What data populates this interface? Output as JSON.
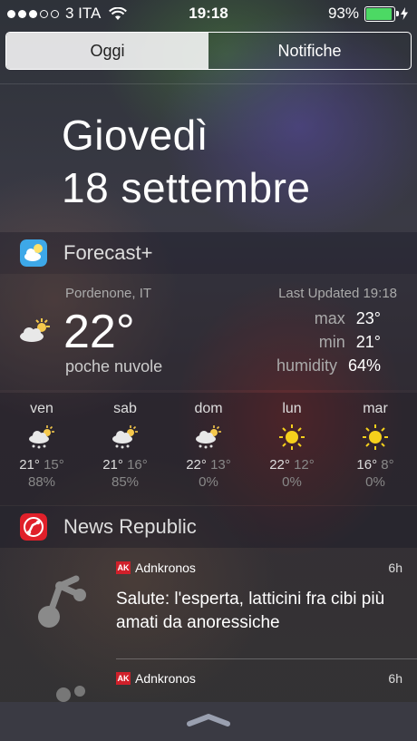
{
  "status": {
    "carrier": "3 ITA",
    "time": "19:18",
    "battery": "93%",
    "battery_level": 0.93
  },
  "tabs": [
    {
      "label": "Oggi",
      "active": true
    },
    {
      "label": "Notifiche",
      "active": false
    }
  ],
  "date": {
    "weekday": "Giovedì",
    "day_month": "18 settembre"
  },
  "forecast_widget": {
    "app_name": "Forecast+",
    "location": "Pordenone, IT",
    "updated": "Last Updated 19:18",
    "temperature": "22°",
    "description": "poche nuvole",
    "stats": [
      {
        "label": "max",
        "value": "23°"
      },
      {
        "label": "min",
        "value": "21°"
      },
      {
        "label": "humidity",
        "value": "64%"
      }
    ],
    "days": [
      {
        "name": "ven",
        "high": "21°",
        "low": "15°",
        "precip": "88%",
        "icon": "rain-cloud-sun-icon"
      },
      {
        "name": "sab",
        "high": "21°",
        "low": "16°",
        "precip": "85%",
        "icon": "rain-cloud-sun-icon"
      },
      {
        "name": "dom",
        "high": "22°",
        "low": "13°",
        "precip": "0%",
        "icon": "rain-cloud-sun-icon"
      },
      {
        "name": "lun",
        "high": "22°",
        "low": "12°",
        "precip": "0%",
        "icon": "sun-icon"
      },
      {
        "name": "mar",
        "high": "16°",
        "low": "8°",
        "precip": "0%",
        "icon": "sun-icon"
      }
    ]
  },
  "news_widget": {
    "app_name": "News Republic",
    "items": [
      {
        "source": "Adnkronos",
        "time": "6h",
        "headline": "Salute: l'esperta, latticini fra cibi più amati da anoressiche"
      },
      {
        "source": "Adnkronos",
        "time": "6h",
        "headline": ""
      }
    ]
  },
  "colors": {
    "battery_fill": "#4cd964",
    "adnkronos_red": "#d0202a",
    "news_republic_red": "#e0202a",
    "forecast_blue": "#3da8e8"
  }
}
